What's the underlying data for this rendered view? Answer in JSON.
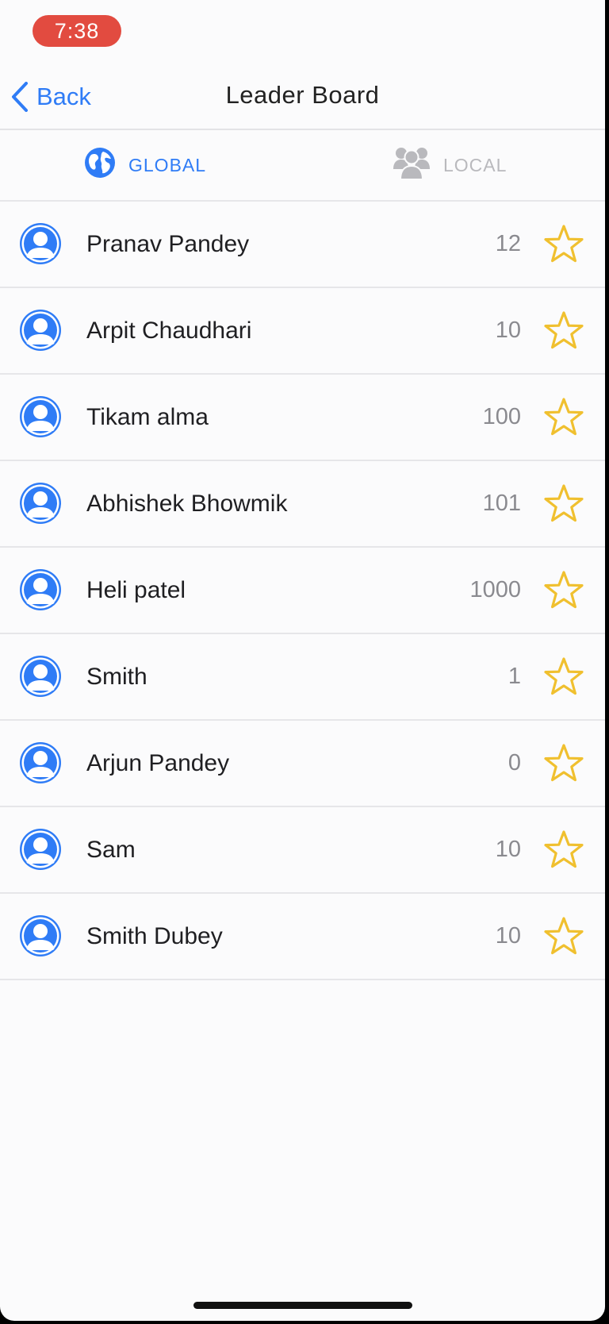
{
  "status_bar": {
    "time": "7:38"
  },
  "nav": {
    "back_label": "Back",
    "title": "Leader Board"
  },
  "tabs": [
    {
      "label": "GLOBAL",
      "icon": "globe-icon",
      "active": true
    },
    {
      "label": "LOCAL",
      "icon": "group-icon",
      "active": false
    }
  ],
  "leaderboard": [
    {
      "name": "Pranav Pandey",
      "score": "12"
    },
    {
      "name": "Arpit Chaudhari",
      "score": "10"
    },
    {
      "name": "Tikam alma",
      "score": "100"
    },
    {
      "name": "Abhishek Bhowmik",
      "score": "101"
    },
    {
      "name": "Heli patel",
      "score": "1000"
    },
    {
      "name": "Smith",
      "score": "1"
    },
    {
      "name": "Arjun Pandey",
      "score": "0"
    },
    {
      "name": "Sam",
      "score": "10"
    },
    {
      "name": "Smith Dubey",
      "score": "10"
    }
  ],
  "colors": {
    "accent": "#2f7cf6",
    "star": "#f0c02f",
    "time_pill": "#e24b40",
    "inactive_tab": "#b9b9bd"
  }
}
